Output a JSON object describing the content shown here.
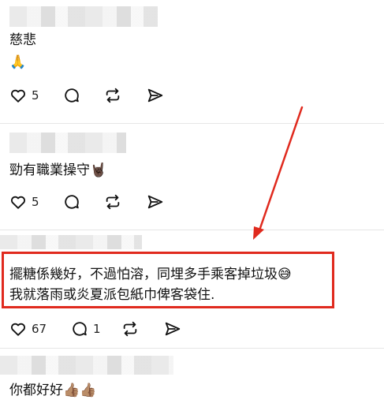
{
  "posts": [
    {
      "text": "慈悲",
      "emoji": "🙏",
      "likes": "5"
    },
    {
      "text": "勁有職業操守",
      "emoji": "🤘🏿",
      "likes": "5"
    },
    {
      "line1": "擺糖係幾好，不過怕溶，同埋多手乘客掉垃圾",
      "line1_emoji": "😅",
      "line2": "我就落雨或炎夏派包紙巾俾客袋住.",
      "likes": "67",
      "comments": "1"
    },
    {
      "text": "你都好好",
      "emoji": "👍🏽👍🏽"
    }
  ],
  "colors": {
    "highlight": "#e02a1e"
  },
  "icons": [
    "heart-icon",
    "comment-icon",
    "repost-icon",
    "share-icon"
  ]
}
